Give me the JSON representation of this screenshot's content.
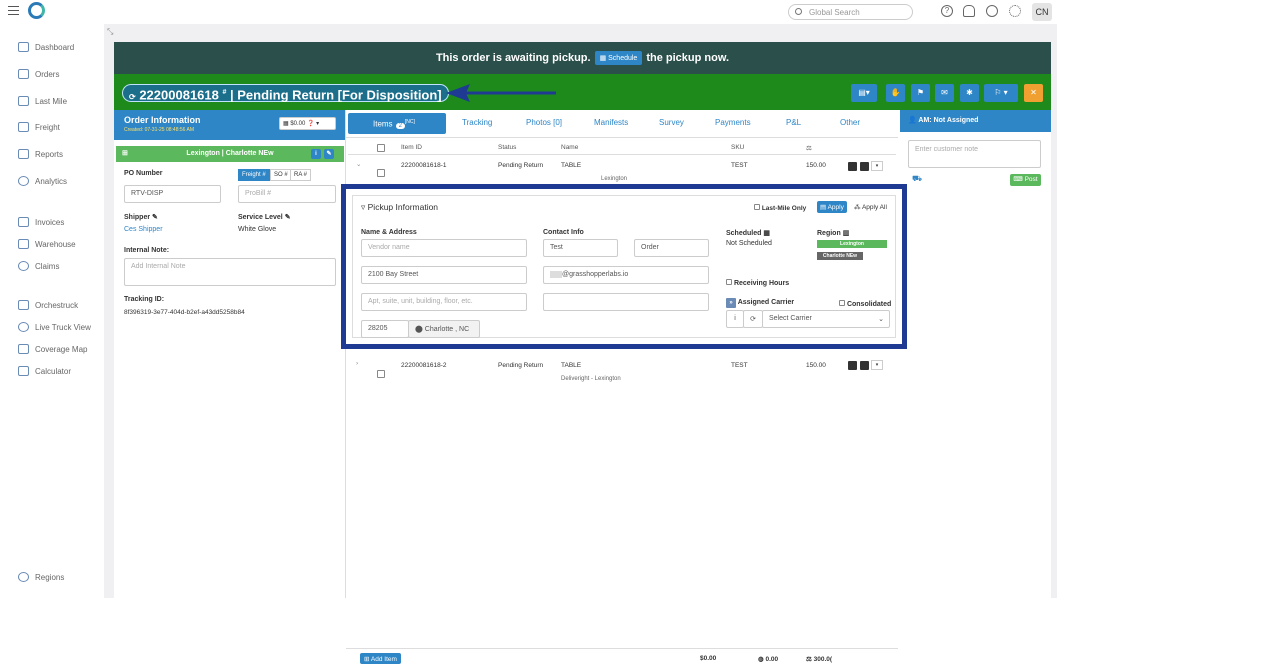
{
  "topbar": {
    "search_placeholder": "Global Search",
    "avatar_initials": "CN"
  },
  "nav": {
    "items": [
      "Dashboard",
      "Orders",
      "Last Mile",
      "Freight",
      "Reports",
      "Analytics",
      "Invoices",
      "Warehouse",
      "Claims",
      "Orchestruck",
      "Live Truck View",
      "Coverage Map",
      "Calculator"
    ],
    "bottom": "Regions"
  },
  "banner": {
    "before": "This order is awaiting pickup.",
    "button": "Schedule",
    "after": "the pickup now."
  },
  "order": {
    "title": "22200081618",
    "status": "| Pending Return [For Disposition]"
  },
  "order_info": {
    "title": "Order Information",
    "created": "Created: 07-31-25 08:48:56 AM",
    "money": "$0.00",
    "location": "Lexington | Charlotte NEw",
    "po_label": "PO Number",
    "po_value": "RTV-DISP",
    "pill_freight": "Freight #",
    "pill_so": "SO #",
    "pill_ra": "RA #",
    "probill_placeholder": "ProBill #",
    "shipper_label": "Shipper",
    "shipper_value": "Ces Shipper",
    "service_label": "Service Level",
    "service_value": "White Glove",
    "note_label": "Internal Note:",
    "note_placeholder": "Add Internal Note",
    "tracking_label": "Tracking ID:",
    "tracking_value": "8f396319-3e77-404d-b2ef-a43dd5258b84"
  },
  "tabs": [
    {
      "label": "Items",
      "count": "2",
      "tag": "[NC]"
    },
    {
      "label": "Tracking"
    },
    {
      "label": "Photos [0]"
    },
    {
      "label": "Manifests"
    },
    {
      "label": "Survey"
    },
    {
      "label": "Payments"
    },
    {
      "label": "P&L"
    },
    {
      "label": "Other"
    }
  ],
  "table": {
    "headers": [
      "Item ID",
      "Status",
      "Name",
      "SKU"
    ],
    "rows": [
      {
        "id": "22200081618-1",
        "status": "Pending Return",
        "name": "TABLE",
        "sub": "Lexington",
        "sku": "TEST",
        "amount": "150.00"
      },
      {
        "id": "22200081618-2",
        "status": "Pending Return",
        "name": "TABLE",
        "sub": "Deliveright - Lexington",
        "sku": "TEST",
        "amount": "150.00"
      }
    ]
  },
  "pickup": {
    "title": "Pickup Information",
    "last_mile_only": "Last-Mile Only",
    "apply": "Apply",
    "apply_all": "Apply All",
    "name_address_label": "Name & Address",
    "vendor_placeholder": "Vendor name",
    "street": "2100 Bay Street",
    "apt_placeholder": "Apt, suite, unit, building, floor, etc.",
    "zip": "28205",
    "city": "Charlotte , NC",
    "contact_label": "Contact Info",
    "contact_first": "Test",
    "contact_last": "Order",
    "email": "@grasshopperlabs.io",
    "scheduled_label": "Scheduled",
    "scheduled_value": "Not Scheduled",
    "region_label": "Region",
    "region_tag1": "Lexington",
    "region_tag2": "Charlotte NEw",
    "receiving_hours": "Receiving Hours",
    "assigned_carrier": "Assigned Carrier",
    "consolidated": "Consolidated",
    "carrier_placeholder": "Select Carrier"
  },
  "footer": {
    "add_item": "Add Item",
    "total1": "$0.00",
    "total2": "0.00",
    "total3": "300.0("
  },
  "right": {
    "am": "AM: Not Assigned",
    "note_placeholder": "Enter customer note",
    "post": "Post"
  },
  "colors": {
    "primary": "#2e86c7",
    "header_green": "#1f8a1c",
    "banner": "#2b4f4a",
    "location_green": "#5cb85c",
    "highlight_border": "#1f3a93"
  }
}
